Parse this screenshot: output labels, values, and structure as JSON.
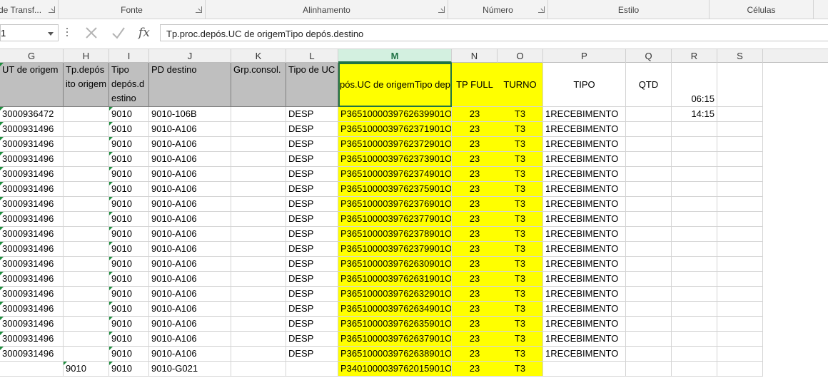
{
  "ribbon": {
    "groups": [
      {
        "label": "de Transf...",
        "launcher": true
      },
      {
        "label": "Fonte",
        "launcher": true
      },
      {
        "label": "Alinhamento",
        "launcher": true
      },
      {
        "label": "Número",
        "launcher": true
      },
      {
        "label": "Estilo",
        "launcher": false
      },
      {
        "label": "Células",
        "launcher": false
      }
    ]
  },
  "formula_bar": {
    "name_box_value": "1",
    "cancel_icon": "cancel-x-icon",
    "enter_icon": "checkmark-icon",
    "fx_label": "fx",
    "content": "Tp.proc.depós.UC de origemTipo depós.destino"
  },
  "columns": [
    {
      "letter": "G"
    },
    {
      "letter": "H"
    },
    {
      "letter": "I"
    },
    {
      "letter": "J"
    },
    {
      "letter": "K"
    },
    {
      "letter": "L"
    },
    {
      "letter": "M",
      "active": true
    },
    {
      "letter": "N"
    },
    {
      "letter": "O"
    },
    {
      "letter": "P"
    },
    {
      "letter": "Q"
    },
    {
      "letter": "R"
    },
    {
      "letter": "S"
    }
  ],
  "header_row": {
    "G": "UT de origem",
    "H": "Tp.depós ito origem",
    "I": "Tipo depós.d estino",
    "J": "PD destino",
    "K": "Grp.consol.",
    "L": "Tipo de UC",
    "M": "pós.UC de origemTipo depós.destino",
    "N": "TP FULL",
    "O": "TURNO",
    "P": "TIPO",
    "Q": "QTD",
    "R": "06:15"
  },
  "rows": [
    {
      "G": "3000936472",
      "H": "",
      "I": "9010",
      "J": "9010-106B",
      "K": "",
      "L": "DESP",
      "M": "P3651000039762639901O",
      "N": "23",
      "O": "T3",
      "P": "1RECEBIMENTO",
      "Q": "",
      "R": "14:15"
    },
    {
      "G": "3000931496",
      "H": "",
      "I": "9010",
      "J": "9010-A106",
      "K": "",
      "L": "DESP",
      "M": "P3651000039762371901O",
      "N": "23",
      "O": "T3",
      "P": "1RECEBIMENTO",
      "Q": "",
      "R": ""
    },
    {
      "G": "3000931496",
      "H": "",
      "I": "9010",
      "J": "9010-A106",
      "K": "",
      "L": "DESP",
      "M": "P3651000039762372901O",
      "N": "23",
      "O": "T3",
      "P": "1RECEBIMENTO",
      "Q": "",
      "R": ""
    },
    {
      "G": "3000931496",
      "H": "",
      "I": "9010",
      "J": "9010-A106",
      "K": "",
      "L": "DESP",
      "M": "P3651000039762373901O",
      "N": "23",
      "O": "T3",
      "P": "1RECEBIMENTO",
      "Q": "",
      "R": ""
    },
    {
      "G": "3000931496",
      "H": "",
      "I": "9010",
      "J": "9010-A106",
      "K": "",
      "L": "DESP",
      "M": "P3651000039762374901O",
      "N": "23",
      "O": "T3",
      "P": "1RECEBIMENTO",
      "Q": "",
      "R": ""
    },
    {
      "G": "3000931496",
      "H": "",
      "I": "9010",
      "J": "9010-A106",
      "K": "",
      "L": "DESP",
      "M": "P3651000039762375901O",
      "N": "23",
      "O": "T3",
      "P": "1RECEBIMENTO",
      "Q": "",
      "R": ""
    },
    {
      "G": "3000931496",
      "H": "",
      "I": "9010",
      "J": "9010-A106",
      "K": "",
      "L": "DESP",
      "M": "P3651000039762376901O",
      "N": "23",
      "O": "T3",
      "P": "1RECEBIMENTO",
      "Q": "",
      "R": ""
    },
    {
      "G": "3000931496",
      "H": "",
      "I": "9010",
      "J": "9010-A106",
      "K": "",
      "L": "DESP",
      "M": "P3651000039762377901O",
      "N": "23",
      "O": "T3",
      "P": "1RECEBIMENTO",
      "Q": "",
      "R": ""
    },
    {
      "G": "3000931496",
      "H": "",
      "I": "9010",
      "J": "9010-A106",
      "K": "",
      "L": "DESP",
      "M": "P3651000039762378901O",
      "N": "23",
      "O": "T3",
      "P": "1RECEBIMENTO",
      "Q": "",
      "R": ""
    },
    {
      "G": "3000931496",
      "H": "",
      "I": "9010",
      "J": "9010-A106",
      "K": "",
      "L": "DESP",
      "M": "P3651000039762379901O",
      "N": "23",
      "O": "T3",
      "P": "1RECEBIMENTO",
      "Q": "",
      "R": ""
    },
    {
      "G": "3000931496",
      "H": "",
      "I": "9010",
      "J": "9010-A106",
      "K": "",
      "L": "DESP",
      "M": "P3651000039762630901O",
      "N": "23",
      "O": "T3",
      "P": "1RECEBIMENTO",
      "Q": "",
      "R": ""
    },
    {
      "G": "3000931496",
      "H": "",
      "I": "9010",
      "J": "9010-A106",
      "K": "",
      "L": "DESP",
      "M": "P3651000039762631901O",
      "N": "23",
      "O": "T3",
      "P": "1RECEBIMENTO",
      "Q": "",
      "R": ""
    },
    {
      "G": "3000931496",
      "H": "",
      "I": "9010",
      "J": "9010-A106",
      "K": "",
      "L": "DESP",
      "M": "P3651000039762632901O",
      "N": "23",
      "O": "T3",
      "P": "1RECEBIMENTO",
      "Q": "",
      "R": ""
    },
    {
      "G": "3000931496",
      "H": "",
      "I": "9010",
      "J": "9010-A106",
      "K": "",
      "L": "DESP",
      "M": "P3651000039762634901O",
      "N": "23",
      "O": "T3",
      "P": "1RECEBIMENTO",
      "Q": "",
      "R": ""
    },
    {
      "G": "3000931496",
      "H": "",
      "I": "9010",
      "J": "9010-A106",
      "K": "",
      "L": "DESP",
      "M": "P3651000039762635901O",
      "N": "23",
      "O": "T3",
      "P": "1RECEBIMENTO",
      "Q": "",
      "R": ""
    },
    {
      "G": "3000931496",
      "H": "",
      "I": "9010",
      "J": "9010-A106",
      "K": "",
      "L": "DESP",
      "M": "P3651000039762637901O",
      "N": "23",
      "O": "T3",
      "P": "1RECEBIMENTO",
      "Q": "",
      "R": ""
    },
    {
      "G": "3000931496",
      "H": "",
      "I": "9010",
      "J": "9010-A106",
      "K": "",
      "L": "DESP",
      "M": "P3651000039762638901O",
      "N": "23",
      "O": "T3",
      "P": "1RECEBIMENTO",
      "Q": "",
      "R": ""
    },
    {
      "G": "",
      "H": "9010",
      "I": "9010",
      "J": "9010-G021",
      "K": "",
      "L": "",
      "M": "P3401000039762015901O",
      "N": "23",
      "O": "T3",
      "P": "",
      "Q": "",
      "R": ""
    }
  ],
  "colors": {
    "highlight": "#ffff00",
    "header_fill": "#bfbfbf",
    "active_column": "#217346",
    "error_indicator": "#1e8e3e"
  }
}
